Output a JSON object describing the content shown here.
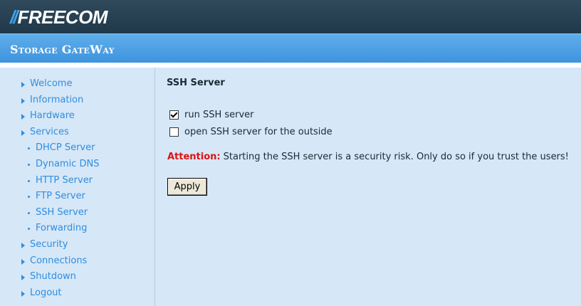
{
  "header": {
    "logo_slashes": "//",
    "logo_text": "FREECOM",
    "subtitle": "Storage GateWay"
  },
  "sidebar": {
    "items": [
      {
        "label": "Welcome",
        "type": "top"
      },
      {
        "label": "Information",
        "type": "top"
      },
      {
        "label": "Hardware",
        "type": "top"
      },
      {
        "label": "Services",
        "type": "top"
      },
      {
        "label": "DHCP Server",
        "type": "sub"
      },
      {
        "label": "Dynamic DNS",
        "type": "sub"
      },
      {
        "label": "HTTP Server",
        "type": "sub"
      },
      {
        "label": "FTP Server",
        "type": "sub"
      },
      {
        "label": "SSH Server",
        "type": "sub"
      },
      {
        "label": "Forwarding",
        "type": "sub"
      },
      {
        "label": "Security",
        "type": "top"
      },
      {
        "label": "Connections",
        "type": "top"
      },
      {
        "label": "Shutdown",
        "type": "top"
      },
      {
        "label": "Logout",
        "type": "top"
      }
    ]
  },
  "main": {
    "title": "SSH Server",
    "options": [
      {
        "label": "run SSH server",
        "checked": true
      },
      {
        "label": "open SSH server for the outside",
        "checked": false
      }
    ],
    "attention_label": "Attention:",
    "attention_text": "Starting the SSH server is a security risk. Only do so if you trust the users!",
    "apply_label": "Apply"
  },
  "colors": {
    "accent": "#2e8ee0",
    "warning": "#dd1111",
    "header_dark": "#20384a",
    "header_blue": "#4aa0e4",
    "background": "#d6e7f7"
  }
}
